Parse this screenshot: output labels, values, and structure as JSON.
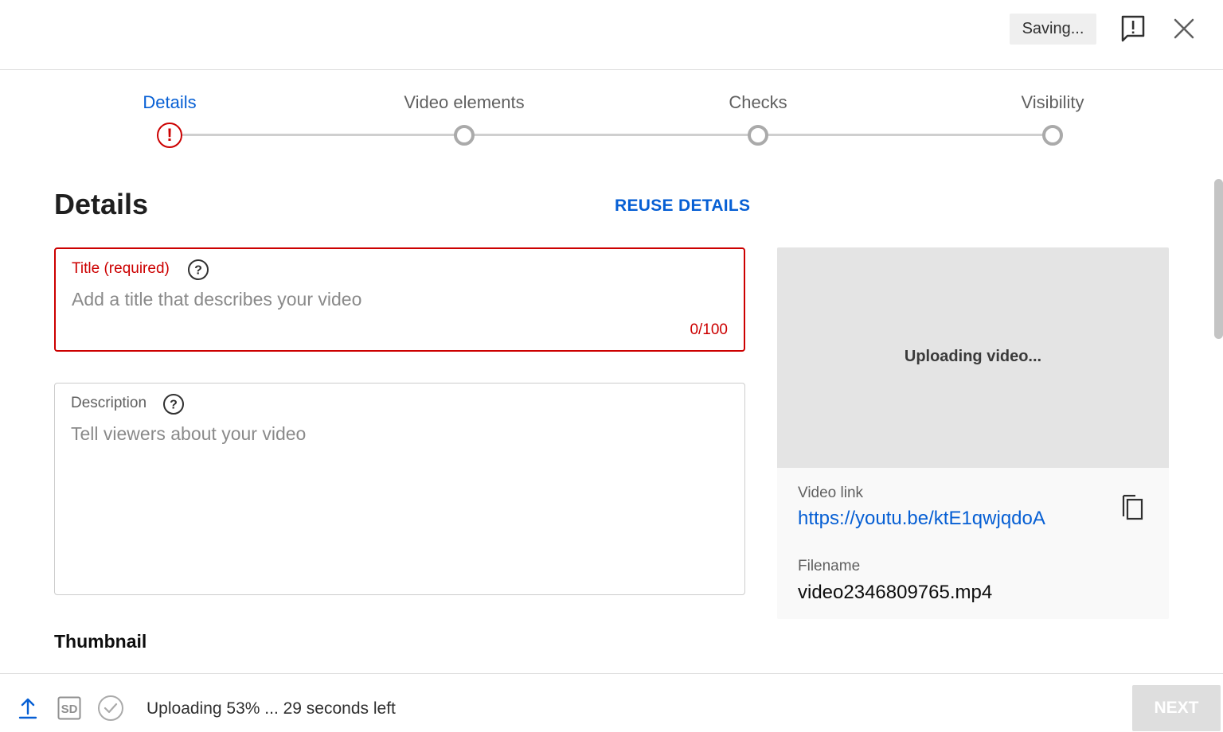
{
  "header": {
    "saving_label": "Saving..."
  },
  "stepper": {
    "steps": [
      {
        "label": "Details",
        "state": "error"
      },
      {
        "label": "Video elements",
        "state": "pending"
      },
      {
        "label": "Checks",
        "state": "pending"
      },
      {
        "label": "Visibility",
        "state": "pending"
      }
    ],
    "error_glyph": "!"
  },
  "main": {
    "page_title": "Details",
    "reuse_label": "REUSE DETAILS",
    "title_field": {
      "label": "Title (required)",
      "placeholder": "Add a title that describes your video",
      "value": "",
      "counter": "0/100"
    },
    "description_field": {
      "label": "Description",
      "placeholder": "Tell viewers about your video",
      "value": ""
    },
    "thumbnail_heading": "Thumbnail"
  },
  "preview": {
    "status_text": "Uploading video...",
    "video_link_label": "Video link",
    "video_link": "https://youtu.be/ktE1qwjqdoA",
    "filename_label": "Filename",
    "filename": "video2346809765.mp4"
  },
  "footer": {
    "quality_badge": "SD",
    "upload_status": "Uploading 53% ... 29 seconds left",
    "upload_progress_percent": 53,
    "next_label": "NEXT"
  },
  "colors": {
    "accent": "#065fd4",
    "error": "#cc0000",
    "muted": "#606060"
  },
  "icons": {
    "feedback": "feedback-icon",
    "close": "close-icon",
    "help": "help-icon",
    "copy": "copy-icon",
    "upload": "upload-icon",
    "sd": "sd-quality-icon",
    "check": "check-circle-icon"
  }
}
